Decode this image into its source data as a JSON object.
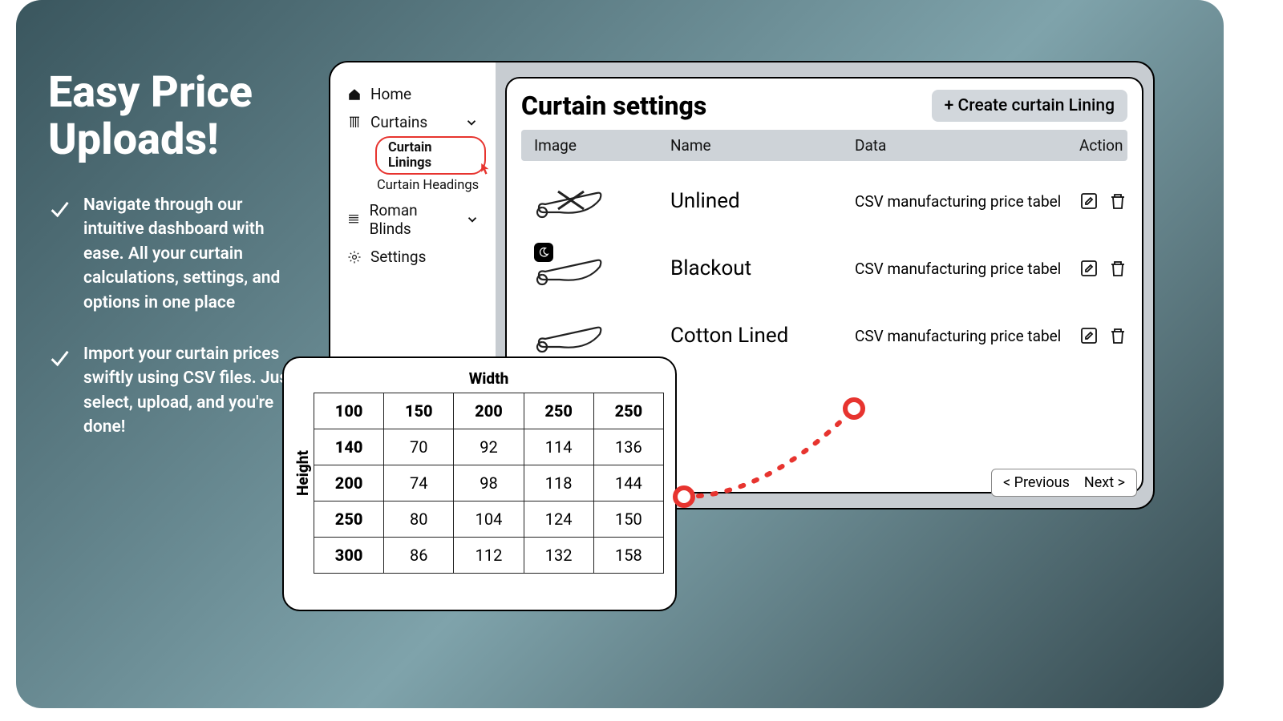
{
  "promo": {
    "title": "Easy Price Uploads!",
    "bullets": [
      "Navigate through our intuitive dashboard with ease. All your curtain calculations, settings, and options in one place",
      "Import your curtain prices swiftly using CSV files. Just select, upload, and you're done!"
    ]
  },
  "sidebar": {
    "items": [
      {
        "label": "Home"
      },
      {
        "label": "Curtains",
        "expanded": true,
        "sub": [
          {
            "label": "Curtain Linings",
            "active": true
          },
          {
            "label": "Curtain Headings"
          }
        ]
      },
      {
        "label": "Roman Blinds",
        "expanded": true
      },
      {
        "label": "Settings"
      }
    ]
  },
  "main": {
    "title": "Curtain settings",
    "create_btn": "+ Create curtain Lining",
    "columns": {
      "image": "Image",
      "name": "Name",
      "data": "Data",
      "action": "Action"
    },
    "rows": [
      {
        "name": "Unlined",
        "data": "CSV manufacturing price tabel",
        "kind": "unlined"
      },
      {
        "name": "Blackout",
        "data": "CSV manufacturing price tabel",
        "kind": "blackout"
      },
      {
        "name": "Cotton Lined",
        "data": "CSV manufacturing price tabel",
        "kind": "cotton"
      }
    ],
    "pager": {
      "prev": "< Previous",
      "next": "Next >"
    }
  },
  "price_table": {
    "width_label": "Width",
    "height_label": "Height",
    "grid": [
      [
        "100",
        "150",
        "200",
        "250",
        "250"
      ],
      [
        "140",
        "70",
        "92",
        "114",
        "136"
      ],
      [
        "200",
        "74",
        "98",
        "118",
        "144"
      ],
      [
        "250",
        "80",
        "104",
        "124",
        "150"
      ],
      [
        "300",
        "86",
        "112",
        "132",
        "158"
      ]
    ]
  },
  "chart_data": {
    "type": "table",
    "title": "Width",
    "ylabel": "Height",
    "columns": [
      "150",
      "200",
      "250",
      "250"
    ],
    "rows": [
      "140",
      "200",
      "250",
      "300"
    ],
    "values": [
      [
        70,
        92,
        114,
        136
      ],
      [
        74,
        98,
        118,
        144
      ],
      [
        80,
        104,
        124,
        150
      ],
      [
        86,
        112,
        132,
        158
      ]
    ],
    "corner_header": "100"
  }
}
